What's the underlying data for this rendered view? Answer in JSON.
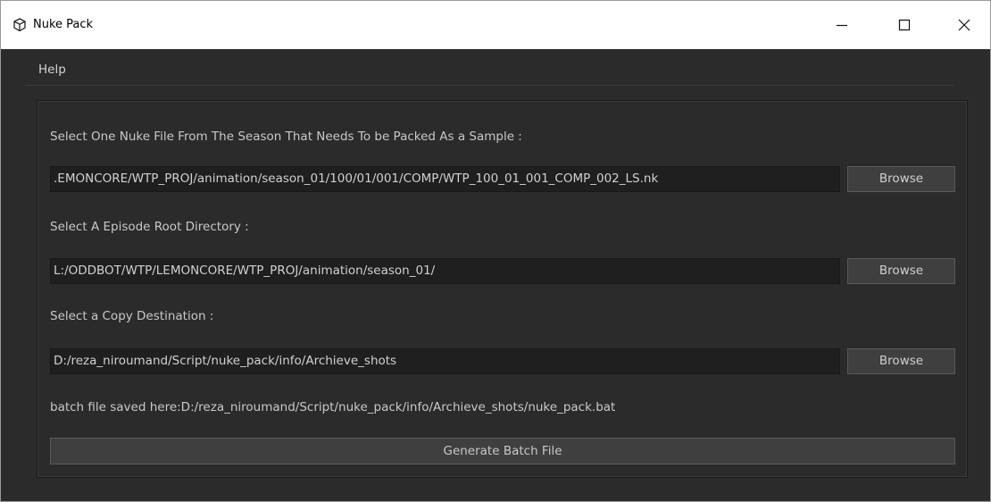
{
  "window": {
    "title": "Nuke Pack",
    "app_icon": "cube-icon",
    "controls": [
      "minimize-icon",
      "maximize-icon",
      "close-icon"
    ]
  },
  "menu": {
    "help": "Help"
  },
  "sample_file": {
    "label": "Select One Nuke File From The Season That Needs To be Packed As a Sample :",
    "value": ".EMONCORE/WTP_PROJ/animation/season_01/100/01/001/COMP/WTP_100_01_001_COMP_002_LS.nk",
    "browse_label": "Browse"
  },
  "episode_root": {
    "label": "Select A Episode Root Directory :",
    "value": "L:/ODDBOT/WTP/LEMONCORE/WTP_PROJ/animation/season_01/",
    "browse_label": "Browse"
  },
  "copy_destination": {
    "label": "Select a Copy Destination :",
    "value": "D:/reza_niroumand/Script/nuke_pack/info/Archieve_shots",
    "browse_label": "Browse"
  },
  "status": {
    "text": "batch file saved here:D:/reza_niroumand/Script/nuke_pack/info/Archieve_shots/nuke_pack.bat"
  },
  "actions": {
    "generate_label": "Generate Batch File"
  },
  "colors": {
    "background": "#2b2b2b",
    "field": "#1f1f1f",
    "button": "#3f3f3f",
    "text": "#c8c8c8"
  }
}
